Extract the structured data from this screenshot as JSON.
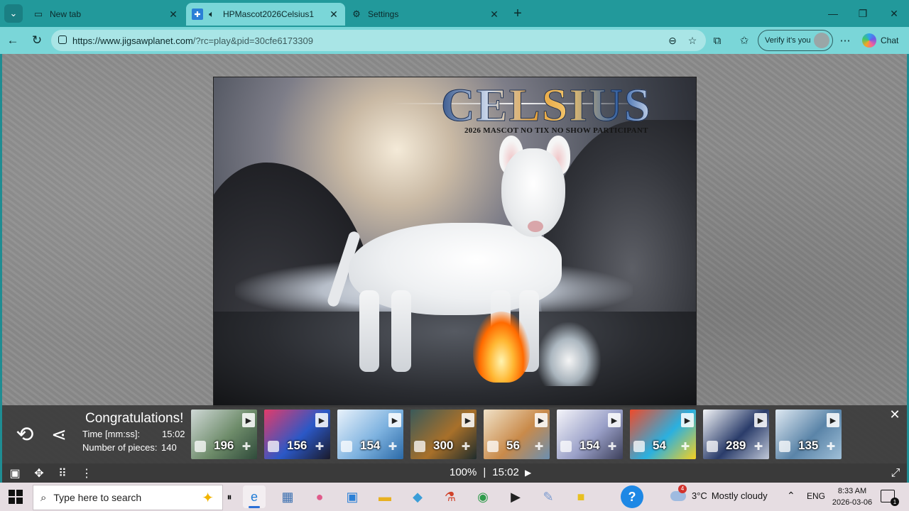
{
  "browser": {
    "tabs": [
      {
        "label": "New tab",
        "icon": "newtab-icon"
      },
      {
        "label": "HPMascot2026Celsius1",
        "icon": "jigsaw-icon",
        "audio": true
      },
      {
        "label": "Settings",
        "icon": "gear-icon"
      }
    ],
    "url_domain": "https://www.jigsawplanet.com",
    "url_rest": "/?rc=play&pid=30cfe6173309",
    "verify_label": "Verify it's you",
    "chat_label": "Chat"
  },
  "puzzle": {
    "title": "CELSIUS",
    "subtitle": "2026 MASCOT NO TIX NO SHOW PARTICIPANT"
  },
  "panel": {
    "congrats": "Congratulations!",
    "time_label": "Time [mm:ss]:",
    "time_value": "15:02",
    "pieces_label": "Number of pieces:",
    "pieces_value": "140",
    "thumbnails": [
      {
        "count": "196",
        "colors": [
          "#cfd8d6",
          "#6e8c6a",
          "#2f4a3a"
        ]
      },
      {
        "count": "156",
        "colors": [
          "#e33b6a",
          "#2b58c7",
          "#1a1a2a"
        ]
      },
      {
        "count": "154",
        "colors": [
          "#e9f2fb",
          "#7fb3e0",
          "#2b6aa8"
        ]
      },
      {
        "count": "300",
        "colors": [
          "#3a5a5a",
          "#a8702a",
          "#1f2c2c"
        ]
      },
      {
        "count": "56",
        "colors": [
          "#f0e2c8",
          "#c98a4a",
          "#6b8fb0"
        ]
      },
      {
        "count": "154",
        "colors": [
          "#f5f5fa",
          "#9aa0c8",
          "#3c3f5a"
        ]
      },
      {
        "count": "54",
        "colors": [
          "#f04a2a",
          "#2ab0e0",
          "#f5d020"
        ]
      },
      {
        "count": "289",
        "colors": [
          "#f4f6f8",
          "#2a3c6a",
          "#c0c8d8"
        ]
      },
      {
        "count": "135",
        "colors": [
          "#dfe9f2",
          "#5a84a8",
          "#a0c0d8"
        ]
      }
    ]
  },
  "toolbar": {
    "zoom": "100%",
    "time": "15:02"
  },
  "taskbar": {
    "search_placeholder": "Type here to search",
    "weather_temp": "3°C",
    "weather_desc": "Mostly cloudy",
    "weather_badge": "4",
    "lang": "ENG",
    "time": "8:33 AM",
    "date": "2026-03-06",
    "notif_count": "1"
  },
  "colors": {
    "tabbar_bg": "#22999b",
    "addrbar_bg": "#7ad6d8",
    "panel_bg": "#3c3c3c",
    "taskbar_bg": "#e6dde2"
  }
}
